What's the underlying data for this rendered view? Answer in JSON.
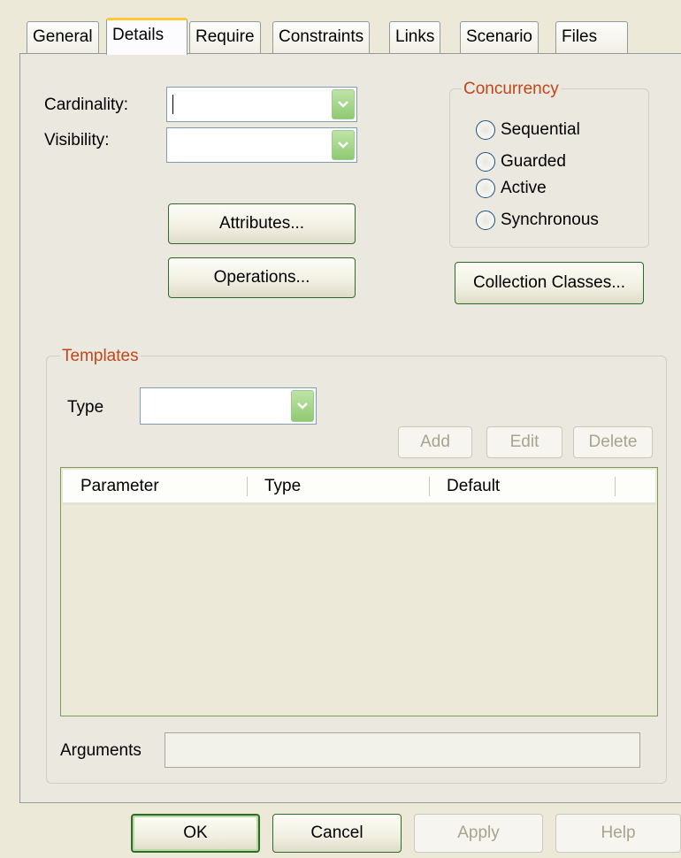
{
  "tabs": [
    "General",
    "Details",
    "Require",
    "Constraints",
    "Links",
    "Scenario",
    "Files"
  ],
  "active_tab": "Details",
  "cardinality": {
    "label": "Cardinality:",
    "value": ""
  },
  "visibility": {
    "label": "Visibility:",
    "value": ""
  },
  "buttons": {
    "attributes": "Attributes...",
    "operations": "Operations...",
    "collection_classes": "Collection Classes..."
  },
  "concurrency": {
    "legend": "Concurrency",
    "options": [
      "Sequential",
      "Guarded",
      "Active",
      "Synchronous"
    ]
  },
  "templates": {
    "legend": "Templates",
    "type_label": "Type",
    "type_value": "",
    "add": "Add",
    "edit": "Edit",
    "delete": "Delete",
    "columns": [
      "Parameter",
      "Type",
      "Default"
    ],
    "rows": [],
    "arguments_label": "Arguments",
    "arguments_value": ""
  },
  "footer": {
    "ok": "OK",
    "cancel": "Cancel",
    "apply": "Apply",
    "help": "Help"
  },
  "colors": {
    "accent_tab": "#ffc83c",
    "legend": "#c0461a",
    "button_border": "#2e6a2a",
    "combo_dropdown": "#8fca72"
  },
  "icons": {
    "dropdown": "chevron-down-icon"
  }
}
